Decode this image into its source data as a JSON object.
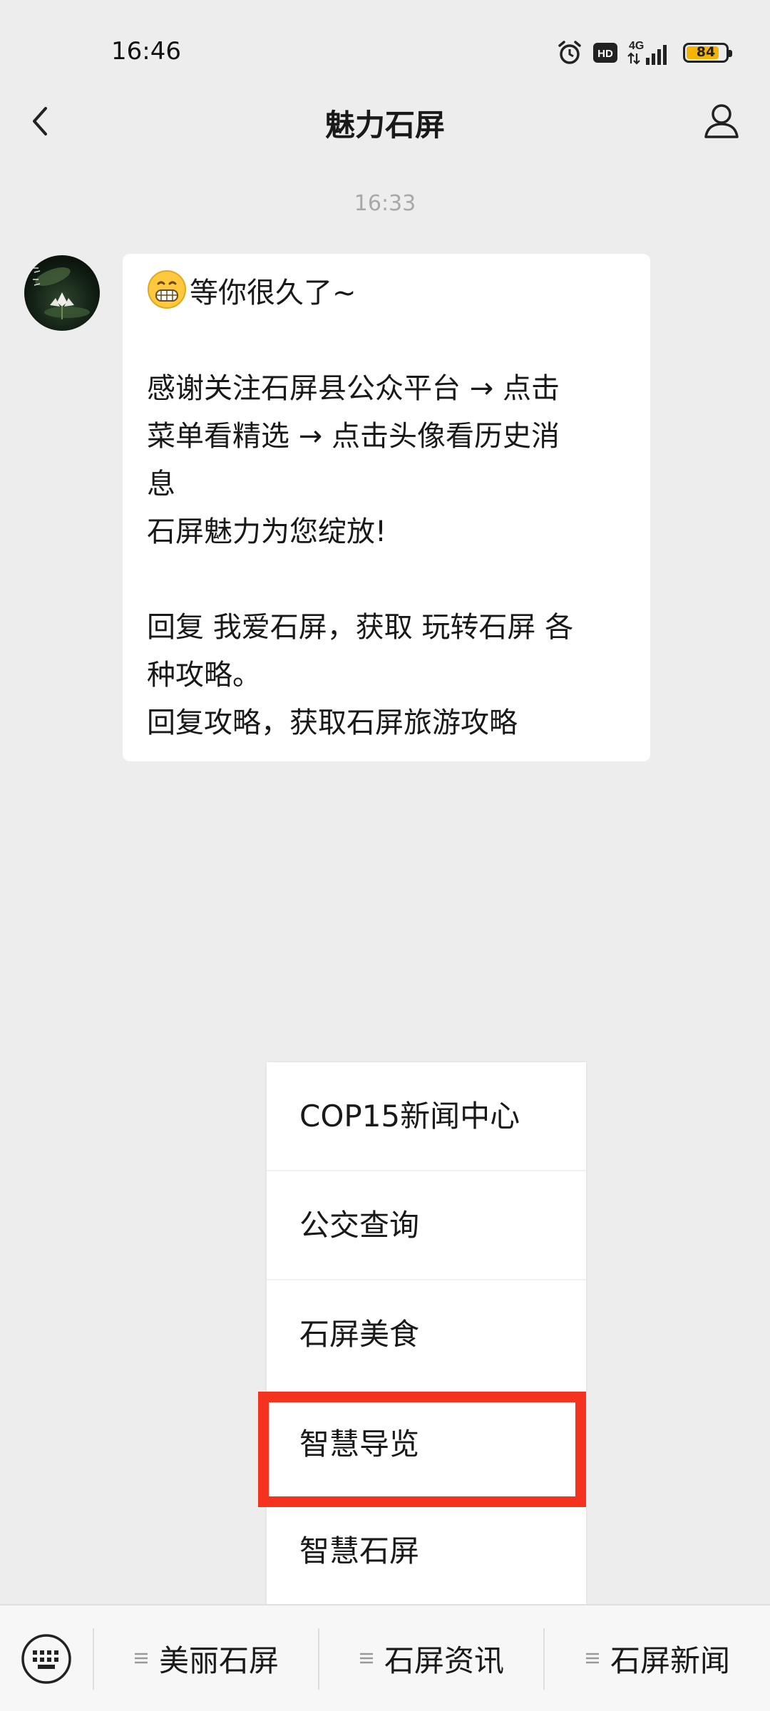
{
  "status_bar": {
    "time": "16:46",
    "network": "4G",
    "hd_label": "HD",
    "battery": "84",
    "icons": [
      "alarm-icon",
      "hd-icon",
      "signal-icon",
      "battery-icon"
    ]
  },
  "header": {
    "title": "魅力石屏",
    "back_icon": "chevron-left-icon",
    "profile_icon": "person-icon"
  },
  "chat": {
    "timestamp": "16:33",
    "message_lines": [
      "等你很久了~",
      "",
      "感谢关注石屏县公众平台 → 点击",
      "菜单看精选 → 点击头像看历史消",
      "息",
      "石屏魅力为您绽放!",
      "",
      "回复 我爱石屏，获取 玩转石屏 各",
      "种攻略。",
      "回复攻略，获取石屏旅游攻略"
    ]
  },
  "popup_menu": {
    "items": [
      "COP15新闻中心",
      "公交查询",
      "石屏美食",
      "智慧导览",
      "智慧石屏"
    ],
    "highlight_color": "#f4321e"
  },
  "bottom_bar": {
    "keyboard_icon": "keyboard-icon",
    "tabs": [
      "美丽石屏",
      "石屏资讯",
      "石屏新闻"
    ]
  }
}
